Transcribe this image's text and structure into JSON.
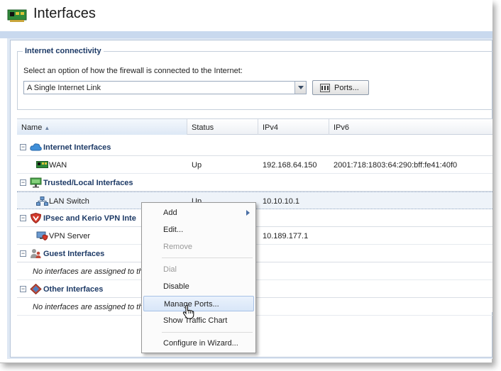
{
  "window": {
    "title": "Interfaces"
  },
  "connectivity": {
    "legend": "Internet connectivity",
    "prompt": "Select an option of how the firewall is connected to the Internet:",
    "selected": "A Single Internet Link",
    "ports_label": "Ports..."
  },
  "grid": {
    "columns": {
      "name": "Name",
      "status": "Status",
      "ipv4": "IPv4",
      "ipv6": "IPv6"
    },
    "groups": {
      "internet": "Internet Interfaces",
      "trusted": "Trusted/Local Interfaces",
      "vpn": "IPsec and Kerio VPN Inte",
      "guest": "Guest Interfaces",
      "other": "Other Interfaces"
    },
    "rows": {
      "wan": {
        "name": "WAN",
        "status": "Up",
        "ipv4": "192.168.64.150",
        "ipv6": "2001:718:1803:64:290:bff:fe41:40f0"
      },
      "lan": {
        "name": "LAN Switch",
        "status": "Up",
        "ipv4": "10.10.10.1"
      },
      "vpn": {
        "name": "VPN Server",
        "ipv4": "10.189.177.1"
      }
    },
    "empty_guest": "No interfaces are assigned to th",
    "empty_other": "No interfaces are assigned to th"
  },
  "context_menu": {
    "add": "Add",
    "edit": "Edit...",
    "remove": "Remove",
    "dial": "Dial",
    "disable": "Disable",
    "manage_ports": "Manage Ports...",
    "traffic_chart": "Show Traffic Chart",
    "wizard": "Configure in Wizard..."
  },
  "icons": {
    "title": "network-card-icon",
    "internet_group": "cloud-icon",
    "trusted_group": "monitor-network-icon",
    "vpn_group": "shield-icon",
    "guest_group": "guest-users-icon",
    "other_group": "diamond-network-icon"
  },
  "colors": {
    "accent": "#1d3a66",
    "band": "#c9d9ee",
    "selection": "#eef3f9"
  }
}
